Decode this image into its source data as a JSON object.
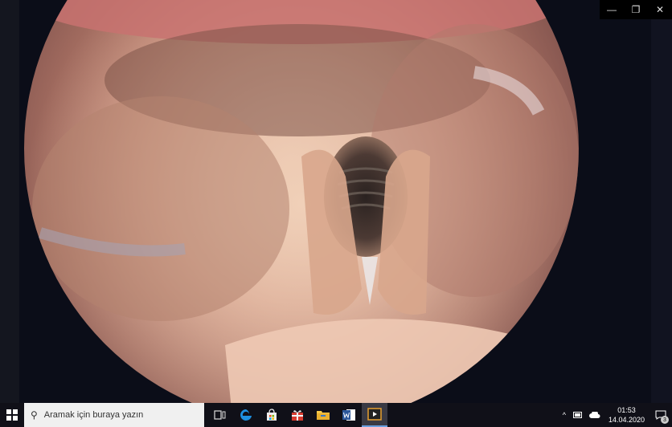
{
  "window": {
    "minimize_glyph": "—",
    "restore_glyph": "❐",
    "close_glyph": "✕"
  },
  "taskbar": {
    "search_placeholder": "Aramak için buraya yazın",
    "apps": [
      {
        "icon": "task-view-icon"
      },
      {
        "icon": "edge-icon"
      },
      {
        "icon": "store-icon"
      },
      {
        "icon": "gift-icon"
      },
      {
        "icon": "file-explorer-icon"
      },
      {
        "icon": "word-icon"
      },
      {
        "icon": "media-player-icon",
        "active": true
      }
    ],
    "tray": {
      "time": "01:53",
      "date": "14.04.2020",
      "notification_count": "3"
    }
  },
  "colors": {
    "taskbar_bg": "#101018",
    "accent": "#6aa0e0"
  }
}
